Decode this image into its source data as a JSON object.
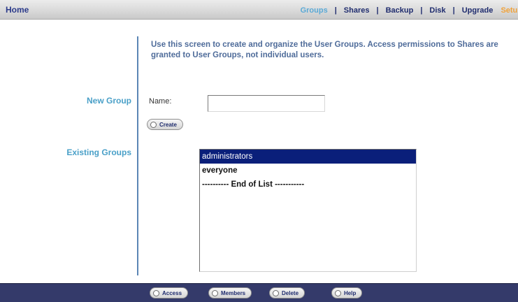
{
  "header": {
    "home_label": "Home",
    "nav": {
      "groups": "Groups",
      "shares": "Shares",
      "backup": "Backup",
      "disk": "Disk",
      "upgrade": "Upgrade",
      "setup": "Setup",
      "separator": "|"
    }
  },
  "intro": {
    "text": "Use this screen to create and organize the User Groups. Access permissions to Shares are granted to User Groups, not individual users."
  },
  "new_group": {
    "section_label": "New Group",
    "name_label": "Name:",
    "name_value": "",
    "create_button": "Create"
  },
  "existing_groups": {
    "section_label": "Existing Groups",
    "items": [
      {
        "label": "administrators",
        "selected": true
      },
      {
        "label": "everyone",
        "selected": false
      },
      {
        "label": "---------- End of List -----------",
        "selected": false
      }
    ]
  },
  "footer": {
    "access_button": "Access",
    "members_button": "Members",
    "delete_button": "Delete",
    "help_button": "Help"
  },
  "colors": {
    "accent_label": "#4aa0c8",
    "nav_active": "#5aa9d6",
    "nav_setup": "#f0a23a",
    "selection": "#0a1f7a",
    "footer_bar": "#343a6a"
  }
}
